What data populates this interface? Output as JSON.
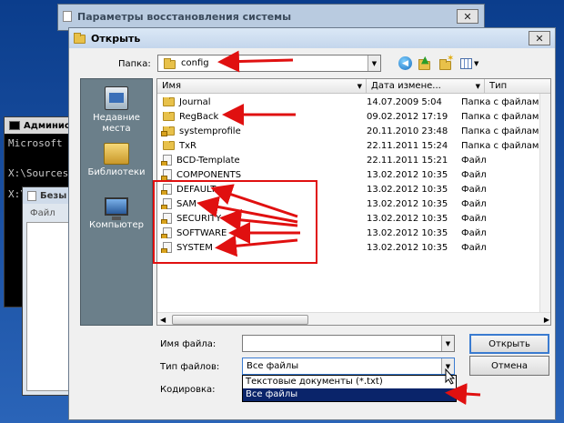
{
  "outer_window": {
    "title": "Параметры восстановления системы"
  },
  "console": {
    "title": "Админис",
    "lines": [
      "Microsoft",
      "X:\\Sources",
      "X:\\"
    ]
  },
  "notepad": {
    "title": "Безы",
    "menu_file": "Файл"
  },
  "dialog": {
    "title": "Открыть",
    "folder_label": "Папка:",
    "folder_value": "config",
    "columns": {
      "name": "Имя",
      "date": "Дата измене...",
      "type": "Тип"
    },
    "places": [
      {
        "label": "Недавние места",
        "icon": "recent-places-icon"
      },
      {
        "label": "Библиотеки",
        "icon": "libraries-icon"
      },
      {
        "label": "Компьютер",
        "icon": "computer-icon"
      }
    ],
    "files": [
      {
        "name": "Journal",
        "date": "14.07.2009 5:04",
        "type": "Папка с файлами",
        "kind": "folder"
      },
      {
        "name": "RegBack",
        "date": "09.02.2012 17:19",
        "type": "Папка с файлами",
        "kind": "folder"
      },
      {
        "name": "systemprofile",
        "date": "20.11.2010 23:48",
        "type": "Папка с файлами",
        "kind": "folder-locked"
      },
      {
        "name": "TxR",
        "date": "22.11.2011 15:24",
        "type": "Папка с файлами",
        "kind": "folder"
      },
      {
        "name": "BCD-Template",
        "date": "22.11.2011 15:21",
        "type": "Файл",
        "kind": "file"
      },
      {
        "name": "COMPONENTS",
        "date": "13.02.2012 10:35",
        "type": "Файл",
        "kind": "file"
      },
      {
        "name": "DEFAULT",
        "date": "13.02.2012 10:35",
        "type": "Файл",
        "kind": "file"
      },
      {
        "name": "SAM",
        "date": "13.02.2012 10:35",
        "type": "Файл",
        "kind": "file"
      },
      {
        "name": "SECURITY",
        "date": "13.02.2012 10:35",
        "type": "Файл",
        "kind": "file"
      },
      {
        "name": "SOFTWARE",
        "date": "13.02.2012 10:35",
        "type": "Файл",
        "kind": "file"
      },
      {
        "name": "SYSTEM",
        "date": "13.02.2012 10:35",
        "type": "Файл",
        "kind": "file"
      }
    ],
    "filename_label": "Имя файла:",
    "filename_value": "",
    "filetype_label": "Тип файлов:",
    "filetype_value": "Все файлы",
    "filetype_options": [
      "Текстовые документы (*.txt)",
      "Все файлы"
    ],
    "encoding_label": "Кодировка:",
    "open_button": "Открыть",
    "cancel_button": "Отмена"
  },
  "colors": {
    "annotation": "#e01010",
    "selection": "#0a246a",
    "places_bg": "#6b7f8a",
    "title_active": "#cfe0f4"
  }
}
